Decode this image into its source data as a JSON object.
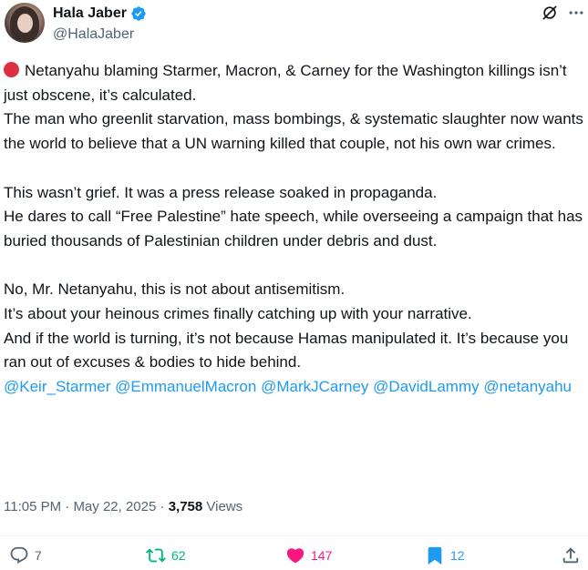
{
  "author": {
    "name": "Hala Jaber",
    "handle": "@HalaJaber"
  },
  "tweet": {
    "paragraphs": [
      {
        "lines": [
          "Netanyahu blaming Starmer, Macron, & Carney for the Washington killings isn’t just obscene, it’s calculated.",
          "The man who greenlit starvation, mass bombings, & systematic slaughter now wants the world to believe that a UN warning killed that couple, not his own war crimes."
        ]
      },
      {
        "lines": [
          "This wasn’t grief. It was a press release soaked in propaganda.",
          "He dares to call “Free Palestine” hate speech, while overseeing a campaign that has buried thousands of Palestinian children under debris and dust."
        ]
      },
      {
        "lines": [
          "No, Mr. Netanyahu, this is not about antisemitism.",
          "It’s about your heinous crimes finally catching up with your narrative.",
          "And if the world is turning, it’s not because Hamas manipulated it. It’s because you ran out of excuses & bodies to hide behind."
        ]
      }
    ],
    "mentions": [
      "@Keir_Starmer",
      "@EmmanuelMacron",
      "@MarkJCarney",
      "@DavidLammy",
      "@netanyahu"
    ]
  },
  "meta": {
    "time": "11:05 PM",
    "separator": "·",
    "date": "May 22, 2025",
    "views_count": "3,758",
    "views_label": "Views"
  },
  "actions": {
    "replies": "7",
    "retweets": "62",
    "likes": "147",
    "bookmarks": "12"
  },
  "colors": {
    "accent": "#1d9bf0",
    "retweet": "#00ba7c",
    "like": "#f91880",
    "text": "#0f1419",
    "secondary": "#536471",
    "red_circle": "#dd2e44"
  },
  "icons": {
    "verified": "verified-badge-icon",
    "grok": "grok-icon",
    "more": "more-icon",
    "reply": "reply-icon",
    "retweet": "retweet-icon",
    "like": "heart-icon",
    "bookmark": "bookmark-icon",
    "share": "share-icon",
    "emoji": "red-circle-icon"
  }
}
